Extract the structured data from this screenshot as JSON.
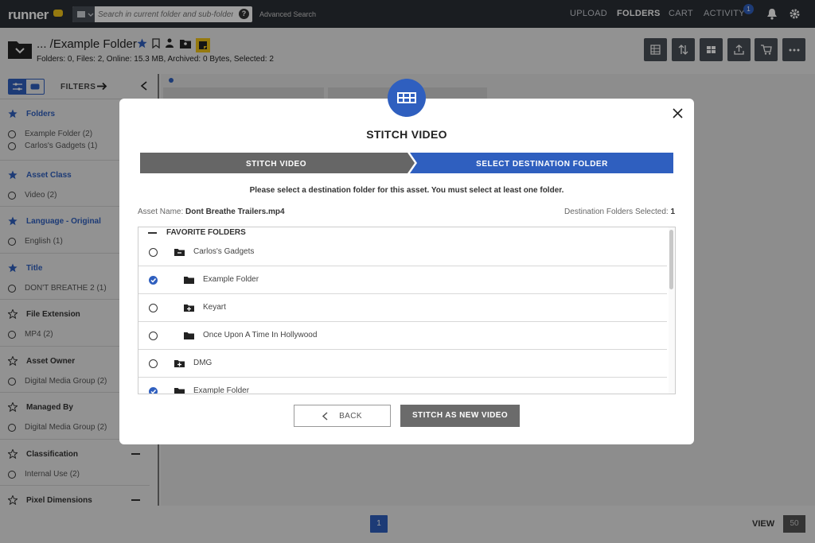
{
  "topbar": {
    "logo": "runner",
    "search_placeholder": "Search in current folder and sub-folder",
    "search_help": "?",
    "advanced_search": "Advanced Search",
    "nav": {
      "upload": "UPLOAD",
      "folders": "FOLDERS",
      "cart": "CART",
      "activity": "ACTIVITY",
      "activity_count": "1"
    }
  },
  "header": {
    "title": "... /Example Folder",
    "stats": "Folders: 0, Files: 2, Online: 15.3 MB, Archived: 0 Bytes, Selected: 2"
  },
  "sidebar": {
    "filters_label": "FILTERS",
    "sections": [
      {
        "title": "Folders",
        "starred": true,
        "items": [
          "Example Folder (2)",
          "Carlos's Gadgets (1)"
        ]
      },
      {
        "title": "Asset Class",
        "starred": true,
        "items": [
          "Video (2)"
        ]
      },
      {
        "title": "Language - Original",
        "starred": true,
        "items": [
          "English (1)"
        ]
      },
      {
        "title": "Title",
        "starred": true,
        "items": [
          "DON'T BREATHE 2 (1)"
        ]
      },
      {
        "title": "File Extension",
        "starred": false,
        "items": [
          "MP4 (2)"
        ]
      },
      {
        "title": "Asset Owner",
        "starred": false,
        "items": [
          "Digital Media Group (2)"
        ]
      },
      {
        "title": "Managed By",
        "starred": false,
        "items": [
          "Digital Media Group (2)"
        ]
      },
      {
        "title": "Classification",
        "starred": false,
        "items": [
          "Internal Use (2)"
        ]
      },
      {
        "title": "Pixel Dimensions",
        "starred": false,
        "items": []
      }
    ]
  },
  "footer": {
    "page": "1",
    "view_label": "VIEW",
    "view_count": "50"
  },
  "modal": {
    "title": "STITCH VIDEO",
    "steps": [
      "STITCH VIDEO",
      "SELECT DESTINATION FOLDER"
    ],
    "instruction": "Please select a destination folder for this asset. You must select at least one folder.",
    "asset_label": "Asset Name:",
    "asset_name": "Dont Breathe Trailers.mp4",
    "dest_label": "Destination Folders Selected:",
    "dest_count": "1",
    "list_header": "FAVORITE FOLDERS",
    "folders": [
      {
        "name": "Carlos's Gadgets",
        "checked": false,
        "icon": "folder-open-icon"
      },
      {
        "name": "Example Folder",
        "checked": true,
        "icon": "folder-icon"
      },
      {
        "name": "Keyart",
        "checked": false,
        "icon": "folder-plus-icon"
      },
      {
        "name": "Once Upon A Time In Hollywood",
        "checked": false,
        "icon": "folder-icon"
      },
      {
        "name": "DMG",
        "checked": false,
        "icon": "folder-plus-icon"
      },
      {
        "name": "Example Folder",
        "checked": true,
        "icon": "folder-icon"
      }
    ],
    "back_label": "BACK",
    "stitch_label": "STITCH AS NEW VIDEO"
  },
  "colors": {
    "accent": "#2f5fbf",
    "topbar": "#2b2f36",
    "step_inactive": "#666666"
  }
}
